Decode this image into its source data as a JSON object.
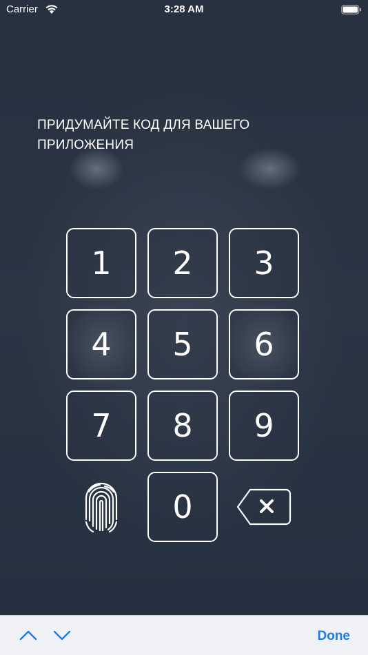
{
  "status_bar": {
    "carrier": "Carrier",
    "time": "3:28 AM",
    "wifi_icon": "wifi-icon",
    "battery_icon": "battery-icon"
  },
  "prompt": {
    "line1": "ПРИДУМАЙТЕ КОД ДЛЯ ВАШЕГО",
    "line2": "ПРИЛОЖЕНИЯ"
  },
  "keypad": {
    "keys": [
      "1",
      "2",
      "3",
      "4",
      "5",
      "6",
      "7",
      "8",
      "9",
      "0"
    ],
    "fingerprint_icon": "fingerprint-icon",
    "backspace_icon": "backspace-icon"
  },
  "toolbar": {
    "up_icon": "chevron-up-icon",
    "down_icon": "chevron-down-icon",
    "done_label": "Done"
  },
  "colors": {
    "background": "#2a3341",
    "key_border": "#ffffff",
    "toolbar_bg": "#f0f1f4",
    "accent": "#1a7ce5"
  }
}
